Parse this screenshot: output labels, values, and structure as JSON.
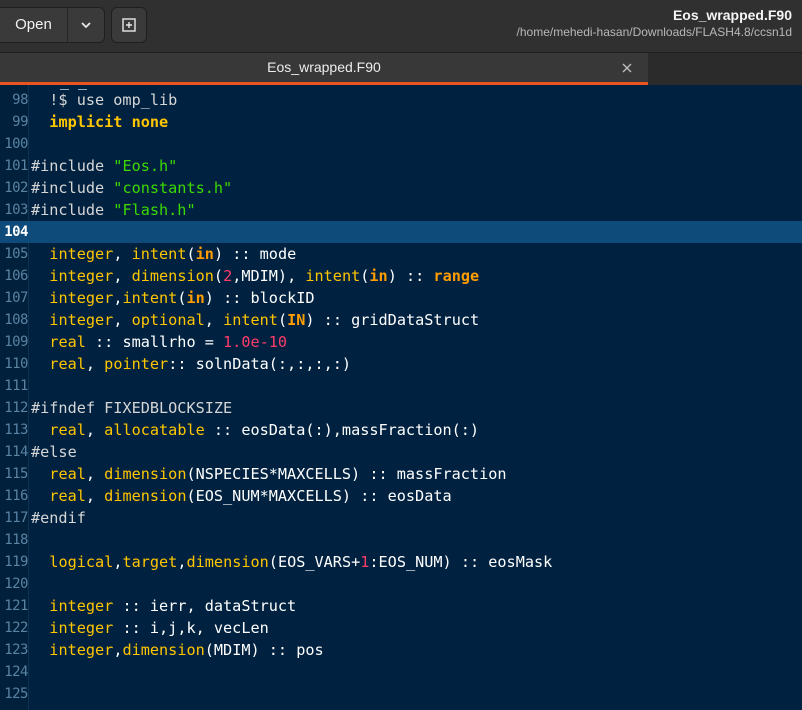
{
  "header": {
    "open_label": "Open",
    "title": "Eos_wrapped.F90",
    "subtitle": "/home/mehedi-hasan/Downloads/FLASH4.8/ccsn1d"
  },
  "tabs": [
    {
      "label": "Eos_wrapped.F90",
      "active": true
    }
  ],
  "colors": {
    "accent": "#e95420",
    "editor_bg": "#002240",
    "current_line": "#0f4b7a",
    "keyword": "#ffc600",
    "string": "#3ad900",
    "number": "#ff3b6a"
  },
  "editor": {
    "current_line": 104,
    "lines": [
      {
        "num": "98",
        "tokens": [
          {
            "t": "  !$ use omp_lib",
            "c": "pre"
          }
        ]
      },
      {
        "num": "99",
        "tokens": [
          {
            "t": "  ",
            "c": ""
          },
          {
            "t": "implicit none",
            "c": "kwb"
          }
        ]
      },
      {
        "num": "100",
        "tokens": []
      },
      {
        "num": "101",
        "tokens": [
          {
            "t": "#include ",
            "c": "pre"
          },
          {
            "t": "\"Eos.h\"",
            "c": "str"
          }
        ]
      },
      {
        "num": "102",
        "tokens": [
          {
            "t": "#include ",
            "c": "pre"
          },
          {
            "t": "\"constants.h\"",
            "c": "str"
          }
        ]
      },
      {
        "num": "103",
        "tokens": [
          {
            "t": "#include ",
            "c": "pre"
          },
          {
            "t": "\"Flash.h\"",
            "c": "str"
          }
        ]
      },
      {
        "num": "104",
        "tokens": []
      },
      {
        "num": "105",
        "tokens": [
          {
            "t": "  ",
            "c": ""
          },
          {
            "t": "integer",
            "c": "kw"
          },
          {
            "t": ", ",
            "c": ""
          },
          {
            "t": "intent",
            "c": "kw"
          },
          {
            "t": "(",
            "c": ""
          },
          {
            "t": "in",
            "c": "kwo"
          },
          {
            "t": ") :: mode",
            "c": ""
          }
        ]
      },
      {
        "num": "106",
        "tokens": [
          {
            "t": "  ",
            "c": ""
          },
          {
            "t": "integer",
            "c": "kw"
          },
          {
            "t": ", ",
            "c": ""
          },
          {
            "t": "dimension",
            "c": "kw"
          },
          {
            "t": "(",
            "c": ""
          },
          {
            "t": "2",
            "c": "num"
          },
          {
            "t": ",MDIM), ",
            "c": ""
          },
          {
            "t": "intent",
            "c": "kw"
          },
          {
            "t": "(",
            "c": ""
          },
          {
            "t": "in",
            "c": "kwo"
          },
          {
            "t": ") :: ",
            "c": ""
          },
          {
            "t": "range",
            "c": "kwo"
          }
        ]
      },
      {
        "num": "107",
        "tokens": [
          {
            "t": "  ",
            "c": ""
          },
          {
            "t": "integer",
            "c": "kw"
          },
          {
            "t": ",",
            "c": ""
          },
          {
            "t": "intent",
            "c": "kw"
          },
          {
            "t": "(",
            "c": ""
          },
          {
            "t": "in",
            "c": "kwo"
          },
          {
            "t": ") :: blockID",
            "c": ""
          }
        ]
      },
      {
        "num": "108",
        "tokens": [
          {
            "t": "  ",
            "c": ""
          },
          {
            "t": "integer",
            "c": "kw"
          },
          {
            "t": ", ",
            "c": ""
          },
          {
            "t": "optional",
            "c": "kw"
          },
          {
            "t": ", ",
            "c": ""
          },
          {
            "t": "intent",
            "c": "kw"
          },
          {
            "t": "(",
            "c": ""
          },
          {
            "t": "IN",
            "c": "kwo"
          },
          {
            "t": ") :: gridDataStruct",
            "c": ""
          }
        ]
      },
      {
        "num": "109",
        "tokens": [
          {
            "t": "  ",
            "c": ""
          },
          {
            "t": "real",
            "c": "kw"
          },
          {
            "t": " :: smallrho = ",
            "c": ""
          },
          {
            "t": "1.0e-10",
            "c": "num"
          }
        ]
      },
      {
        "num": "110",
        "tokens": [
          {
            "t": "  ",
            "c": ""
          },
          {
            "t": "real",
            "c": "kw"
          },
          {
            "t": ", ",
            "c": ""
          },
          {
            "t": "pointer",
            "c": "kw"
          },
          {
            "t": ":: solnData(:,:,:,:)",
            "c": ""
          }
        ]
      },
      {
        "num": "111",
        "tokens": []
      },
      {
        "num": "112",
        "tokens": [
          {
            "t": "#ifndef FIXEDBLOCKSIZE",
            "c": "pre"
          }
        ]
      },
      {
        "num": "113",
        "tokens": [
          {
            "t": "  ",
            "c": ""
          },
          {
            "t": "real",
            "c": "kw"
          },
          {
            "t": ", ",
            "c": ""
          },
          {
            "t": "allocatable",
            "c": "kw"
          },
          {
            "t": " :: eosData(:),massFraction(:)",
            "c": ""
          }
        ]
      },
      {
        "num": "114",
        "tokens": [
          {
            "t": "#else",
            "c": "pre"
          }
        ]
      },
      {
        "num": "115",
        "tokens": [
          {
            "t": "  ",
            "c": ""
          },
          {
            "t": "real",
            "c": "kw"
          },
          {
            "t": ", ",
            "c": ""
          },
          {
            "t": "dimension",
            "c": "kw"
          },
          {
            "t": "(NSPECIES*MAXCELLS) :: massFraction",
            "c": ""
          }
        ]
      },
      {
        "num": "116",
        "tokens": [
          {
            "t": "  ",
            "c": ""
          },
          {
            "t": "real",
            "c": "kw"
          },
          {
            "t": ", ",
            "c": ""
          },
          {
            "t": "dimension",
            "c": "kw"
          },
          {
            "t": "(EOS_NUM*MAXCELLS) :: eosData",
            "c": ""
          }
        ]
      },
      {
        "num": "117",
        "tokens": [
          {
            "t": "#endif",
            "c": "pre"
          }
        ]
      },
      {
        "num": "118",
        "tokens": []
      },
      {
        "num": "119",
        "tokens": [
          {
            "t": "  ",
            "c": ""
          },
          {
            "t": "logical",
            "c": "kw"
          },
          {
            "t": ",",
            "c": ""
          },
          {
            "t": "target",
            "c": "kw"
          },
          {
            "t": ",",
            "c": ""
          },
          {
            "t": "dimension",
            "c": "kw"
          },
          {
            "t": "(EOS_VARS+",
            "c": ""
          },
          {
            "t": "1",
            "c": "num"
          },
          {
            "t": ":EOS_NUM) :: eosMask",
            "c": ""
          }
        ]
      },
      {
        "num": "120",
        "tokens": []
      },
      {
        "num": "121",
        "tokens": [
          {
            "t": "  ",
            "c": ""
          },
          {
            "t": "integer",
            "c": "kw"
          },
          {
            "t": " :: ierr, dataStruct",
            "c": ""
          }
        ]
      },
      {
        "num": "122",
        "tokens": [
          {
            "t": "  ",
            "c": ""
          },
          {
            "t": "integer",
            "c": "kw"
          },
          {
            "t": " :: i,j,k, vecLen",
            "c": ""
          }
        ]
      },
      {
        "num": "123",
        "tokens": [
          {
            "t": "  ",
            "c": ""
          },
          {
            "t": "integer",
            "c": "kw"
          },
          {
            "t": ",",
            "c": ""
          },
          {
            "t": "dimension",
            "c": "kw"
          },
          {
            "t": "(MDIM) :: pos",
            "c": ""
          }
        ]
      },
      {
        "num": "124",
        "tokens": []
      },
      {
        "num": "125",
        "tokens": []
      }
    ]
  }
}
